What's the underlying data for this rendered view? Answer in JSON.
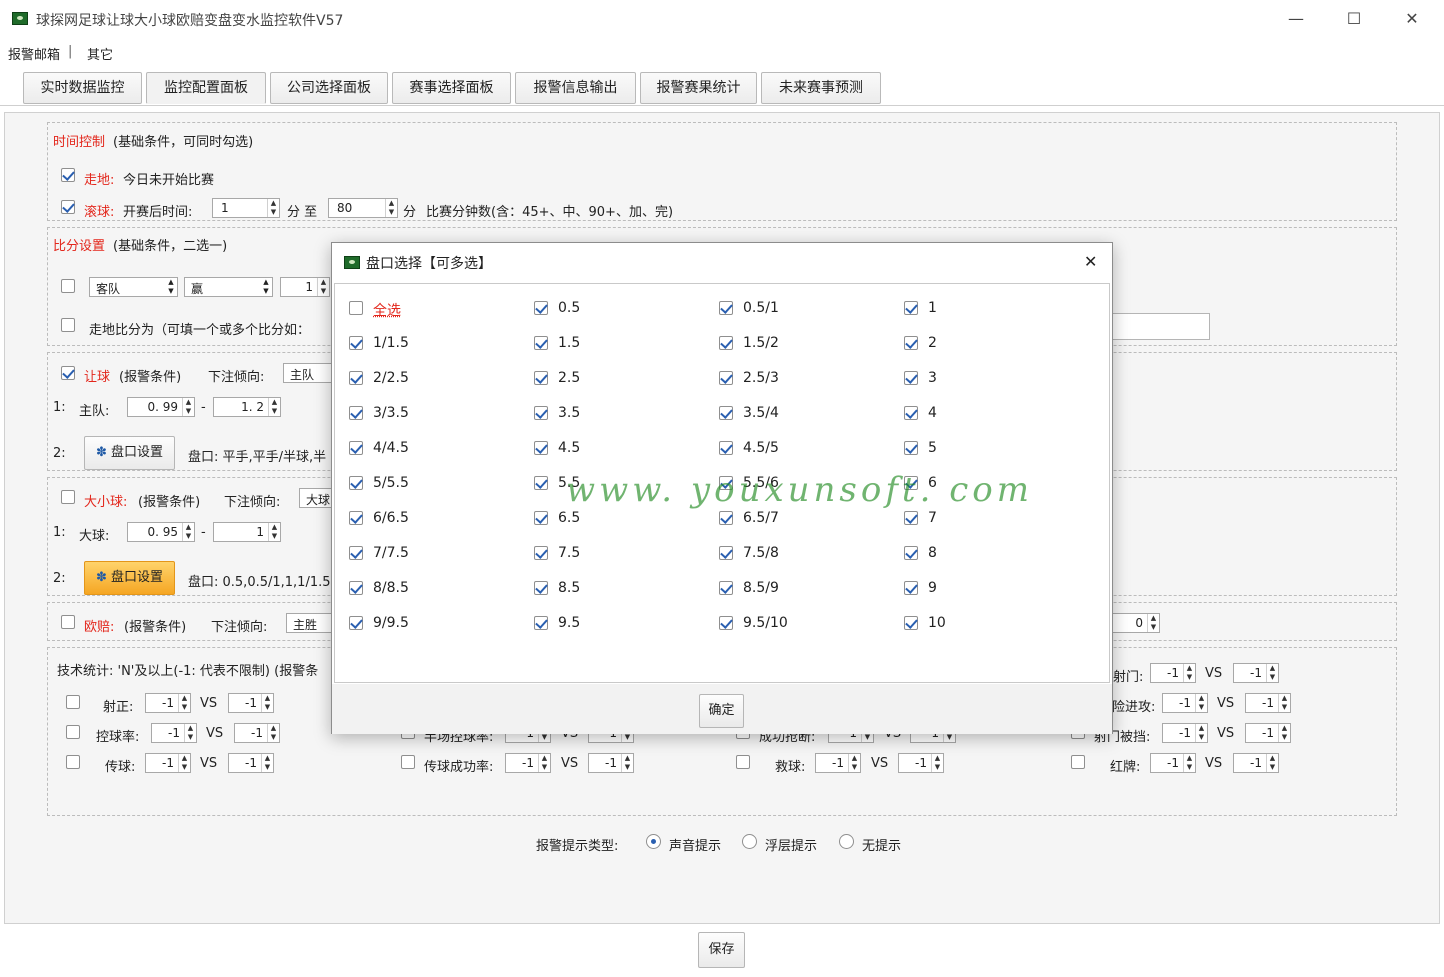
{
  "window": {
    "title": "球探网足球让球大小球欧赔变盘变水监控软件V57",
    "minimize": "—",
    "maximize": "☐",
    "close": "✕"
  },
  "menu": {
    "items": [
      "报警邮箱",
      "其它"
    ],
    "sep": "|"
  },
  "tabs": [
    "实时数据监控",
    "监控配置面板",
    "公司选择面板",
    "赛事选择面板",
    "报警信息输出",
    "报警赛果统计",
    "未来赛事预测"
  ],
  "time": {
    "title": "时间控制",
    "note": "(基础条件，可同时勾选)",
    "zoudi_label": "走地:",
    "zoudi_text": "今日未开始比赛",
    "gunqiu_label": "滚球:",
    "gunqiu_text": "开赛后时间:",
    "from": "1",
    "fen1": "分 至",
    "to": "80",
    "fen2": "分",
    "desc": "比赛分钟数(含：45+、中、90+、加、完)"
  },
  "score": {
    "title": "比分设置",
    "note": "(基础条件，二选一)",
    "team": "客队",
    "result": "赢",
    "num": "1",
    "zoudi_text": "走地比分为（可填一个或多个比分如："
  },
  "handicap": {
    "label": "让球",
    "note": "(报警条件)",
    "trend_label": "下注倾向:",
    "trend": "主队",
    "row1_idx": "1:",
    "row1_label": "主队:",
    "min": "0. 99",
    "dash": "-",
    "max": "1. 2",
    "row2_idx": "2:",
    "btn": "盘口设置",
    "pan": "盘口: 平手,平手/半球,半"
  },
  "overunder": {
    "label": "大小球:",
    "note": "(报警条件)",
    "trend_label": "下注倾向:",
    "trend": "大球",
    "row1_idx": "1:",
    "row1_label": "大球:",
    "min": "0. 95",
    "dash": "-",
    "max": "1",
    "row2_idx": "2:",
    "btn": "盘口设置",
    "pan": "盘口: 0.5,0.5/1,1,1/1.5,"
  },
  "euro": {
    "label": "欧赔:",
    "note": "(报警条件)",
    "trend_label": "下注倾向:",
    "trend": "主胜",
    "val": "0"
  },
  "tech": {
    "title": "技术统计: 'N'及以上(-1: 代表不限制) (报警条",
    "vs": "VS",
    "v": "-1",
    "col1": [
      "射正:",
      "控球率:",
      "传球:"
    ],
    "col2": [
      "半场控球率:",
      "传球成功率:"
    ],
    "col3": [
      "成功抢断:",
      "救球:"
    ],
    "col4": [
      "射门:",
      "险进攻:",
      "射门被挡:",
      "红牌:"
    ]
  },
  "alert": {
    "label": "报警提示类型:",
    "options": [
      "声音提示",
      "浮层提示",
      "无提示"
    ]
  },
  "save": "保存",
  "modal": {
    "title": "盘口选择【可多选】",
    "close": "✕",
    "select_all": "全选",
    "cols": [
      [
        "1/1.5",
        "2/2.5",
        "3/3.5",
        "4/4.5",
        "5/5.5",
        "6/6.5",
        "7/7.5",
        "8/8.5",
        "9/9.5"
      ],
      [
        "0.5",
        "1.5",
        "2.5",
        "3.5",
        "4.5",
        "5.5",
        "6.5",
        "7.5",
        "8.5",
        "9.5"
      ],
      [
        "0.5/1",
        "1.5/2",
        "2.5/3",
        "3.5/4",
        "4.5/5",
        "5.5/6",
        "6.5/7",
        "7.5/8",
        "8.5/9",
        "9.5/10"
      ],
      [
        "1",
        "2",
        "3",
        "4",
        "5",
        "6",
        "7",
        "8",
        "9",
        "10"
      ]
    ],
    "ok": "确定"
  },
  "watermark": "www. youxunsoft. com"
}
